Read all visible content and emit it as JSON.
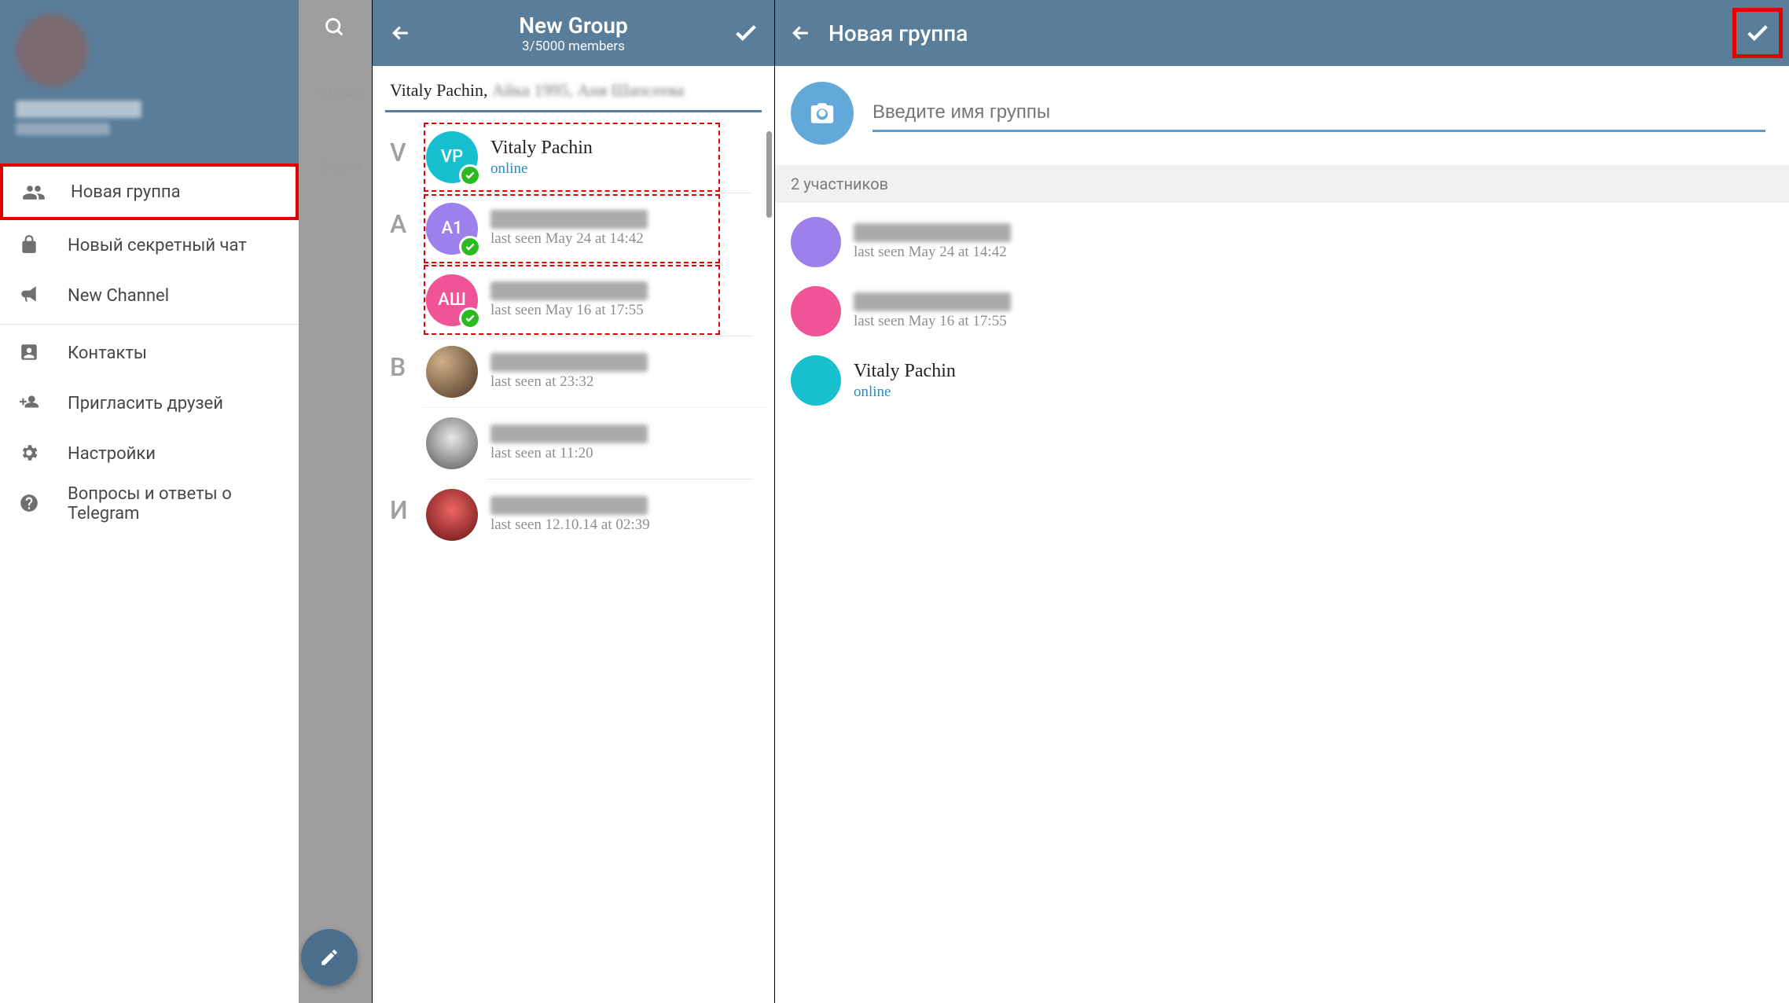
{
  "panel1": {
    "search_icon": "search",
    "chat_preview_dates": [
      "05 окт.",
      "5 сент."
    ],
    "menu": {
      "new_group": "Новая группа",
      "new_secret_chat": "Новый секретный чат",
      "new_channel": "New Channel",
      "contacts": "Контакты",
      "invite_friends": "Пригласить друзей",
      "settings": "Настройки",
      "faq": "Вопросы и ответы о Telegram"
    }
  },
  "panel2": {
    "title": "New Group",
    "subtitle": "3/5000 members",
    "selected_names_visible": "Vitaly Pachin, ",
    "sections": [
      {
        "letter": "V",
        "contacts": [
          {
            "initials": "VP",
            "name": "Vitaly Pachin",
            "status": "online",
            "online": true,
            "selected": true,
            "avatar": "vp"
          }
        ]
      },
      {
        "letter": "A",
        "contacts": [
          {
            "initials": "А1",
            "name_blurred": true,
            "status": "last seen May 24 at 14:42",
            "online": false,
            "selected": true,
            "avatar": "a1"
          },
          {
            "initials": "АШ",
            "name_blurred": true,
            "status": "last seen May 16 at 17:55",
            "online": false,
            "selected": true,
            "avatar": "ash"
          }
        ]
      },
      {
        "letter": "В",
        "contacts": [
          {
            "name_blurred": true,
            "status": "last seen at 23:32",
            "online": false,
            "selected": false,
            "avatar": "photo1"
          },
          {
            "name_blurred": true,
            "status": "last seen at 11:20",
            "online": false,
            "selected": false,
            "avatar": "photo2"
          }
        ]
      },
      {
        "letter": "И",
        "contacts": [
          {
            "name_blurred": true,
            "status": "last seen 12.10.14 at 02:39",
            "online": false,
            "selected": false,
            "avatar": "photo3"
          }
        ]
      }
    ]
  },
  "panel3": {
    "title": "Новая группа",
    "placeholder": "Введите имя группы",
    "members_header": "2 участников",
    "members": [
      {
        "name_blurred": true,
        "status": "last seen May 24 at 14:42",
        "online": false,
        "avatar": "m1"
      },
      {
        "name_blurred": true,
        "status": "last seen May 16 at 17:55",
        "online": false,
        "avatar": "m2"
      },
      {
        "name": "Vitaly Pachin",
        "status": "online",
        "online": true,
        "avatar": "m3"
      }
    ]
  }
}
